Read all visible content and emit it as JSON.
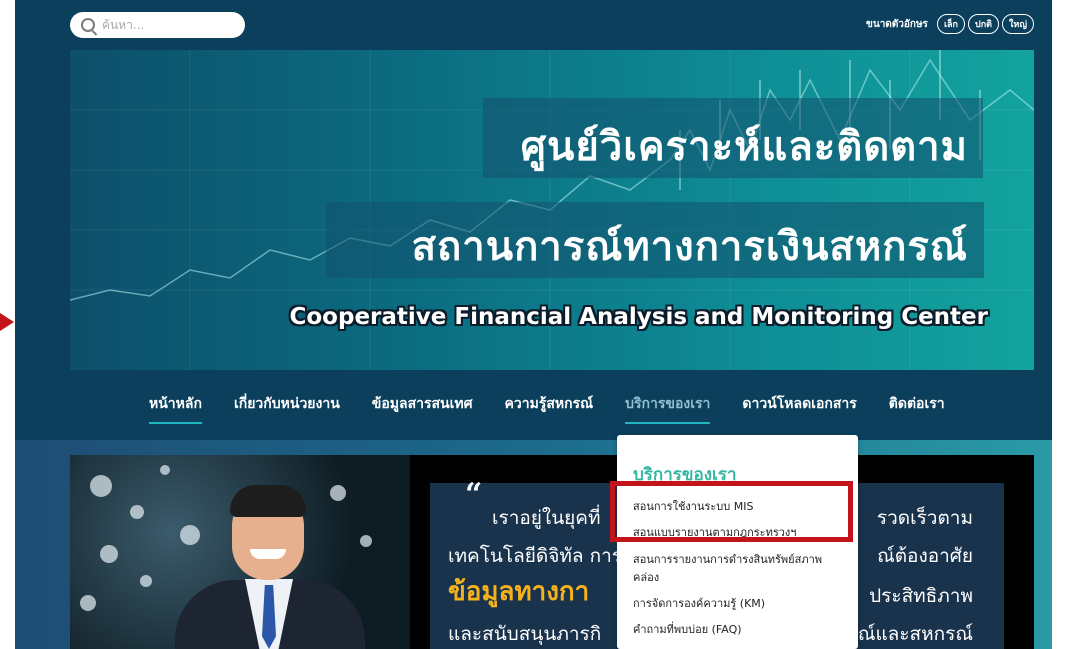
{
  "search": {
    "placeholder": "ค้นหา..."
  },
  "font_size": {
    "label": "ขนาดตัวอักษร",
    "small": "เล็ก",
    "normal": "ปกติ",
    "large": "ใหญ่"
  },
  "banner": {
    "title_line1": "ศูนย์วิเคราะห์และติดตาม",
    "title_line2": "สถานการณ์ทางการเงินสหกรณ์",
    "subtitle": "Cooperative Financial Analysis and Monitoring Center"
  },
  "nav": {
    "items": [
      {
        "label": "หน้าหลัก"
      },
      {
        "label": "เกี่ยวกับหน่วยงาน"
      },
      {
        "label": "ข้อมูลสารสนเทศ"
      },
      {
        "label": "ความรู้สหกรณ์"
      },
      {
        "label": "บริการของเรา"
      },
      {
        "label": "ดาวน์โหลดเอกสาร"
      },
      {
        "label": "ติดต่อเรา"
      }
    ]
  },
  "dropdown": {
    "title": "บริการของเรา",
    "items": [
      "สอนการใช้งานระบบ MIS",
      "สอนแบบรายงานตามกฎกระทรวงฯ",
      "สอนการรายงานการดำรงสินทรัพย์สภาพคล่อง",
      "การจัดการองค์ความรู้ (KM)",
      "คำถามที่พบบ่อย (FAQ)"
    ]
  },
  "quote": {
    "mark": "“",
    "line1_left": "เราอยู่ในยุคที่",
    "line1_right": "รวดเร็วตาม",
    "line2_left": "เทคโนโลยีดิจิทัล การ",
    "line2_right": "ณ์ต้องอาศัย",
    "line3_left": "ข้อมูลทางกา",
    "line3_right": "ประสิทธิภาพ",
    "line4_left": "และสนับสนุนภารกิ",
    "line4_right": "ณ์และสหกรณ์"
  },
  "colors": {
    "page_bg": "#0b3f5c",
    "highlight": "#c4141b",
    "accent": "#36b7a2"
  }
}
